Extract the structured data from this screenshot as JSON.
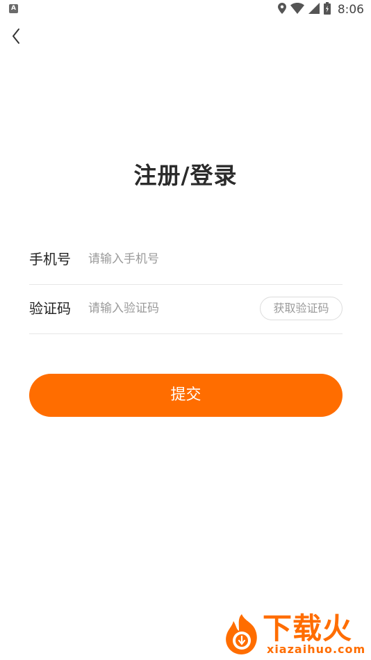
{
  "status_bar": {
    "left_badge": "A",
    "time": "8:06"
  },
  "page": {
    "title": "注册/登录"
  },
  "form": {
    "phone": {
      "label": "手机号",
      "placeholder": "请输入手机号",
      "value": ""
    },
    "code": {
      "label": "验证码",
      "placeholder": "请输入验证码",
      "value": "",
      "get_code_label": "获取验证码"
    },
    "submit_label": "提交"
  },
  "watermark": {
    "brand": "下载火",
    "url": "xiazaihuo.com"
  },
  "colors": {
    "accent": "#ff6d00",
    "divider": "#e6e6e6",
    "placeholder": "#9a9a9a"
  },
  "icons": {
    "status": [
      "location-icon",
      "wifi-icon",
      "signal-icon",
      "battery-icon"
    ],
    "back": "back-arrow-icon"
  }
}
